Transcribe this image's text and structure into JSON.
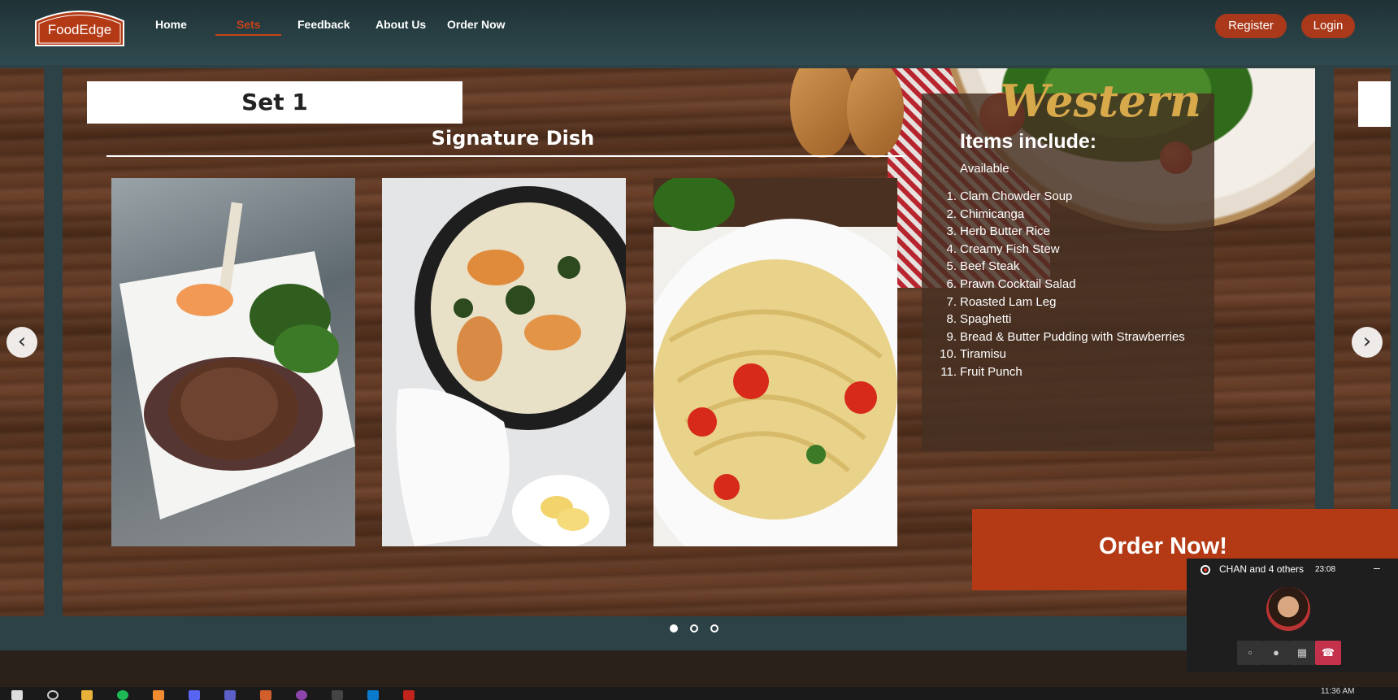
{
  "brand": {
    "name": "FoodEdge"
  },
  "nav": {
    "links": [
      "Home",
      "Sets",
      "Feedback",
      "About Us",
      "Order Now"
    ],
    "active": "Sets",
    "register": "Register",
    "login": "Login"
  },
  "slide": {
    "set_title": "Set 1",
    "section_title": "Signature Dish",
    "cuisine": "Western",
    "items_title": "Items include:",
    "availability": "Available",
    "items": [
      "Clam Chowder Soup",
      "Chimicanga",
      "Herb Butter Rice",
      "Creamy Fish Stew",
      "Beef Steak",
      "Prawn Cocktail Salad",
      "Roasted Lam Leg",
      "Spaghetti",
      "Bread & Butter Pudding with Strawberries",
      "Tiramisu",
      "Fruit Punch"
    ],
    "order_button": "Order Now!"
  },
  "carousel": {
    "current": 1,
    "total": 3,
    "prev_icon": "chevron-left-icon",
    "next_icon": "chevron-right-icon"
  },
  "call": {
    "title": "CHAN and 4 others",
    "duration": "23:08"
  },
  "taskbar": {
    "time": "11:36 AM"
  },
  "colors": {
    "accent": "#c8421a",
    "button": "#a9391a",
    "order": "#b33a14",
    "header": "#2f4a4f"
  }
}
